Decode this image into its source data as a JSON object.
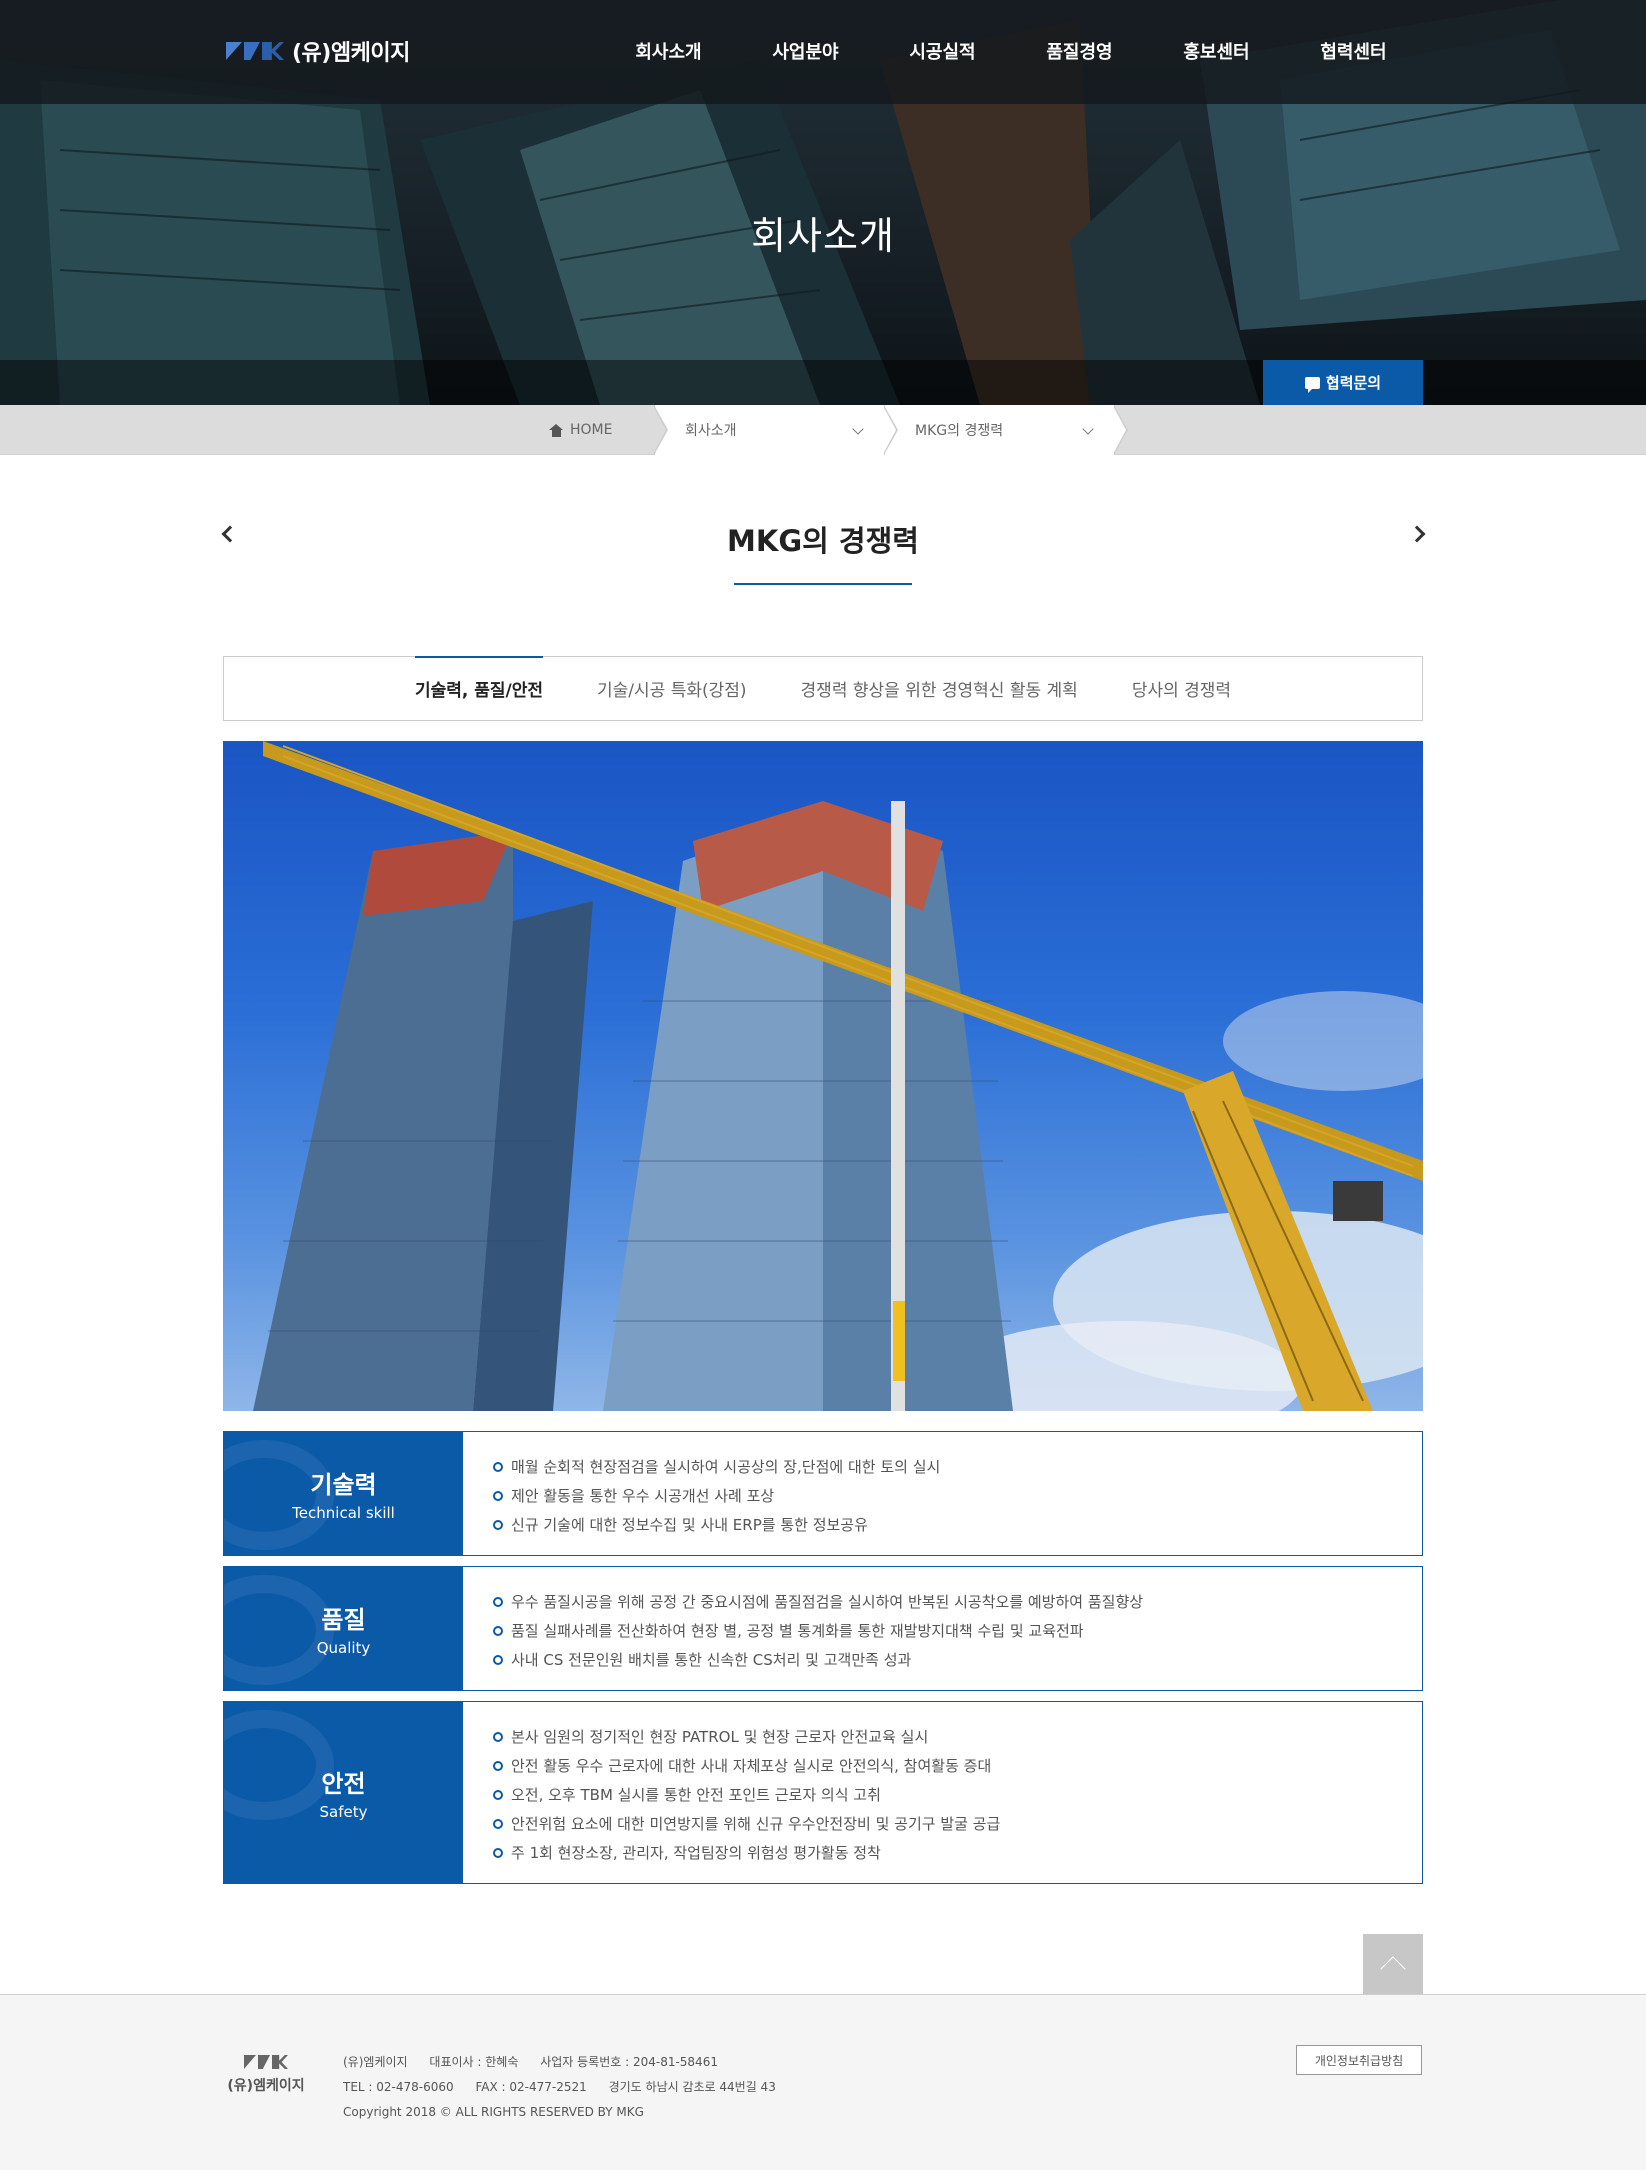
{
  "header": {
    "logo_text": "(유)엠케이지",
    "nav": [
      "회사소개",
      "사업분야",
      "시공실적",
      "품질경영",
      "홍보센터",
      "협력센터"
    ],
    "hero_title": "회사소개",
    "inquiry_label": "협력문의"
  },
  "breadcrumb": {
    "home": "HOME",
    "level1": "회사소개",
    "level2": "MKG의 경쟁력"
  },
  "page": {
    "title": "MKG의 경쟁력"
  },
  "tabs": [
    {
      "label": "기술력, 품질/안전",
      "active": true
    },
    {
      "label": "기술/시공 특화(강점)",
      "active": false
    },
    {
      "label": "경쟁력 향상을 위한 경영혁신 활동 계획",
      "active": false
    },
    {
      "label": "당사의 경쟁력",
      "active": false
    }
  ],
  "sections": [
    {
      "ko": "기술력",
      "en": "Technical skill",
      "items": [
        "매월 순회적 현장점검을 실시하여 시공상의 장,단점에 대한 토의 실시",
        "제안 활동을 통한 우수 시공개선 사례 포상",
        "신규 기술에 대한 정보수집 및 사내 ERP를 통한 정보공유"
      ]
    },
    {
      "ko": "품질",
      "en": "Quality",
      "items": [
        "우수 품질시공을 위해 공정 간 중요시점에 품질점검을 실시하여 반복된 시공착오를 예방하여 품질향상",
        "품질 실패사례를 전산화하여 현장 별, 공정 별 통계화를 통한 재발방지대책 수립 및 교육전파",
        "사내 CS 전문인원 배치를 통한 신속한 CS처리 및 고객만족 성과"
      ]
    },
    {
      "ko": "안전",
      "en": "Safety",
      "items": [
        "본사 임원의 정기적인 현장 PATROL 및 현장 근로자 안전교육 실시",
        "안전 활동 우수 근로자에 대한 사내 자체포상 실시로 안전의식, 참여활동 증대",
        "오전, 오후 TBM 실시를 통한 안전 포인트 근로자 의식 고취",
        "안전위험 요소에 대한 미연방지를 위해 신규 우수안전장비 및 공기구 발굴 공급",
        "주 1회 현장소장, 관리자, 작업팀장의 위험성 평가활동 정착"
      ]
    }
  ],
  "footer": {
    "logo_text": "(유)엠케이지",
    "company": "(유)엠케이지",
    "ceo": "대표이사 : 한혜숙",
    "biz_no": "사업자 등록번호 : 204-81-58461",
    "tel": "TEL : 02-478-6060",
    "fax": "FAX : 02-477-2521",
    "address": "경기도 하남시 감초로 44번길 43",
    "copyright": "Copyright 2018 © ALL RIGHTS RESERVED BY MKG",
    "privacy_label": "개인정보취급방침"
  },
  "colors": {
    "brand_blue": "#0b5aa8",
    "topbar": "#14181c"
  },
  "icons": {
    "home": "home-icon",
    "inquiry": "chat-bubble-icon",
    "prev": "chevron-left-icon",
    "next": "chevron-right-icon",
    "top": "arrow-up-icon",
    "dropdown": "chevron-down-icon"
  }
}
